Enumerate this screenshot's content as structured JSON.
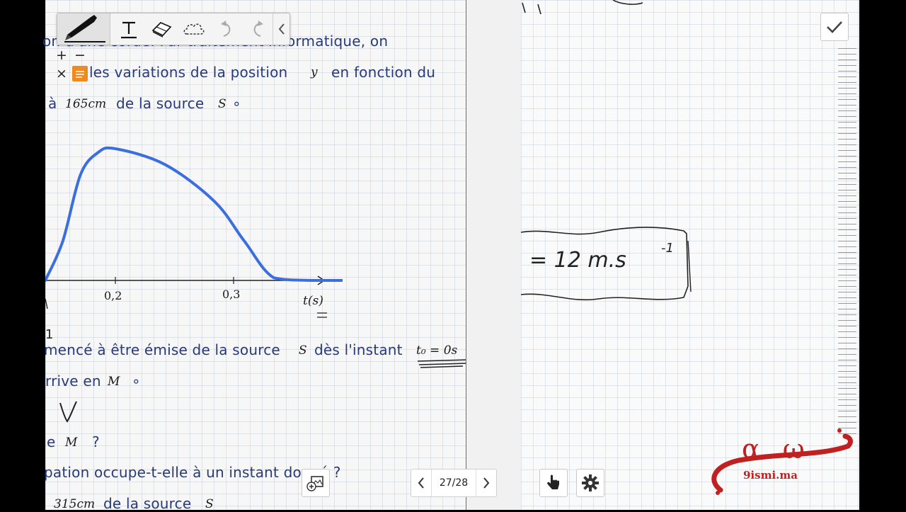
{
  "document": {
    "lines": [
      "on d'une corde. Par traitement informatique, on",
      "les variations de la position",
      "en fonction du",
      "à",
      "de la source",
      "mencé à être émise de la source",
      "dès l'instant",
      "rrive en",
      "e",
      "pation occupe-t-elle à un instant donné ?",
      "de la source"
    ],
    "math": {
      "y": "y",
      "d1": "165cm",
      "S": "S",
      "t0": "t₀ = 0s",
      "M": "M",
      "d2": "315cm"
    },
    "punct": {
      "dot": "∘",
      "q": "?"
    }
  },
  "chart_data": {
    "type": "line",
    "xlabel": "t(s)",
    "x_ticks": [
      "0,2",
      "0,3"
    ],
    "x": [
      0.0,
      0.05,
      0.1,
      0.15,
      0.2,
      0.25,
      0.3,
      0.33,
      0.36,
      0.4,
      0.45,
      0.48
    ],
    "series": [
      {
        "values": [
          0.0,
          0.3,
          0.8,
          0.97,
          1.0,
          0.88,
          0.6,
          0.3,
          0.02,
          0.0,
          0.0,
          0.0
        ]
      }
    ],
    "color": "#3b6fe0"
  },
  "toolbar": {
    "tools": [
      "pen-tool",
      "text-tool",
      "eraser-tool",
      "lasso-tool",
      "undo",
      "redo",
      "collapse"
    ]
  },
  "pager": {
    "label": "27/28"
  },
  "annotations": {
    "speed": "= 12 m.s",
    "speed_exp": "-1"
  },
  "logo": {
    "symbol": "α ω",
    "site": "9ismi.ma"
  },
  "colors": {
    "text": "#283b78",
    "curve": "#3b6fe0",
    "accent": "#f08a1c",
    "logo": "#c02020"
  }
}
